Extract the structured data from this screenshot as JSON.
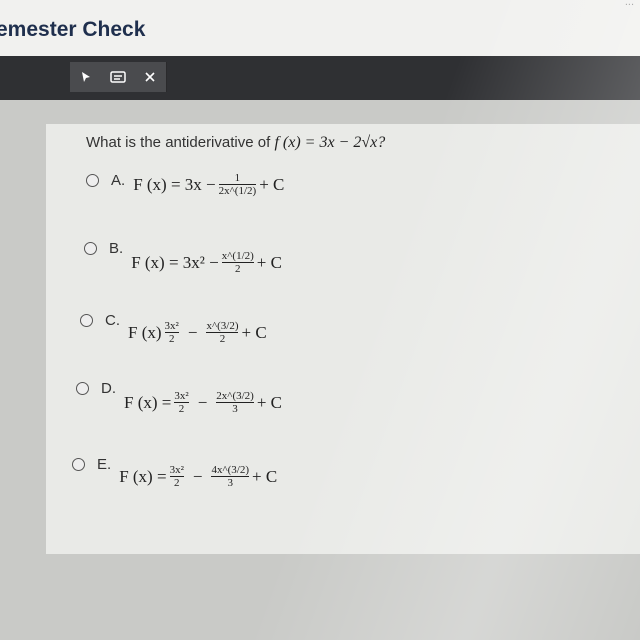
{
  "app": {
    "title": "emester Check",
    "corner_text": "..."
  },
  "toolbar": {
    "pointer_icon": "pointer-icon",
    "notes_icon": "notes-icon",
    "close_icon": "close-icon"
  },
  "question": {
    "prefix": "What is the antiderivative of",
    "expression": "f (x) = 3x − 2√x?"
  },
  "options": [
    {
      "letter": "A.",
      "lhs": "F (x) = 3x −",
      "frac_num": "1",
      "frac_den": "2x^(1/2)",
      "tail": "+ C"
    },
    {
      "letter": "B.",
      "lhs": "F (x) = 3x² −",
      "frac_num": "x^(1/2)",
      "frac_den": "2",
      "tail": "+ C"
    },
    {
      "letter": "C.",
      "lhs": "F (x)",
      "mid_num": "3x²",
      "mid_den": "2",
      "frac_num": "x^(3/2)",
      "frac_den": "2",
      "tail": "+ C"
    },
    {
      "letter": "D.",
      "lhs": "F (x) =",
      "mid_num": "3x²",
      "mid_den": "2",
      "frac_num": "2x^(3/2)",
      "frac_den": "3",
      "tail": "+ C"
    },
    {
      "letter": "E.",
      "lhs": "F (x) =",
      "mid_num": "3x²",
      "mid_den": "2",
      "frac_num": "4x^(3/2)",
      "frac_den": "3",
      "tail": "+ C"
    }
  ]
}
